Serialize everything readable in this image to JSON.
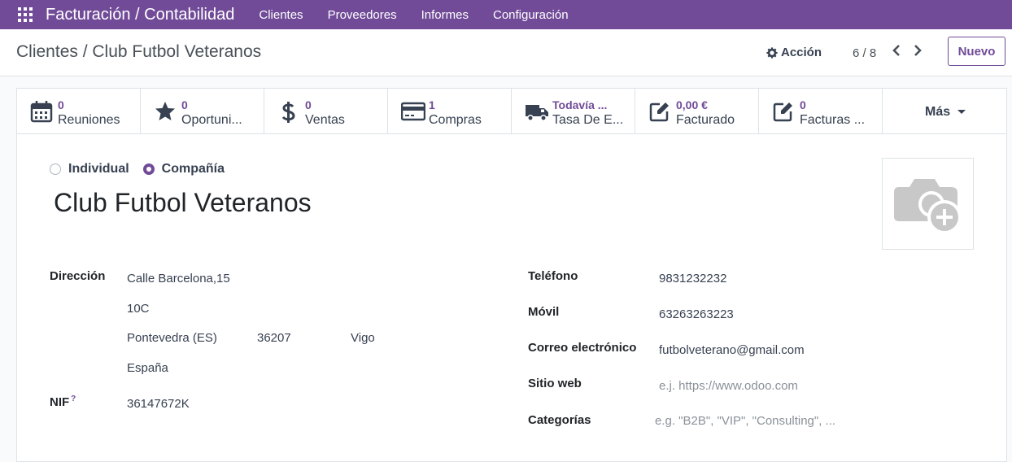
{
  "navbar": {
    "app_title": "Facturación / Contabilidad",
    "menu": [
      "Clientes",
      "Proveedores",
      "Informes",
      "Configuración"
    ]
  },
  "control_panel": {
    "breadcrumb": "Clientes / Club Futbol Veteranos",
    "action_label": "Acción",
    "pager": "6 / 8",
    "new_button": "Nuevo"
  },
  "smart_buttons": [
    {
      "icon": "calendar-icon",
      "value": "0",
      "label": "Reuniones"
    },
    {
      "icon": "star-icon",
      "value": "0",
      "label": "Oportuni..."
    },
    {
      "icon": "dollar-icon",
      "value": "0",
      "label": "Ventas"
    },
    {
      "icon": "credit-card-icon",
      "value": "1",
      "label": "Compras"
    },
    {
      "icon": "truck-icon",
      "value": "Todavía ...",
      "label": "Tasa De E..."
    },
    {
      "icon": "pencil-square-icon",
      "value": "0,00 €",
      "label": "Facturado"
    },
    {
      "icon": "pencil-square-icon",
      "value": "0",
      "label": "Facturas ..."
    }
  ],
  "more_button": "Más",
  "form": {
    "type_individual": "Individual",
    "type_company": "Compañía",
    "selected_type": "Compañía",
    "name": "Club Futbol Veteranos",
    "address_label": "Dirección",
    "street": "Calle Barcelona,15",
    "street2": "10C",
    "state": "Pontevedra (ES)",
    "zip": "36207",
    "city": "Vigo",
    "country": "España",
    "vat_label": "NIF",
    "vat_help": "?",
    "vat": "36147672K",
    "phone_label": "Teléfono",
    "phone": "9831232232",
    "mobile_label": "Móvil",
    "mobile": "63263263223",
    "email_label": "Correo electrónico",
    "email": "futbolveterano@gmail.com",
    "website_label": "Sitio web",
    "website_placeholder": "e.j. https://www.odoo.com",
    "tags_label": "Categorías",
    "tags_placeholder": "e.g. \"B2B\", \"VIP\", \"Consulting\", ..."
  },
  "colors": {
    "brand": "#714b98",
    "text": "#212529"
  }
}
